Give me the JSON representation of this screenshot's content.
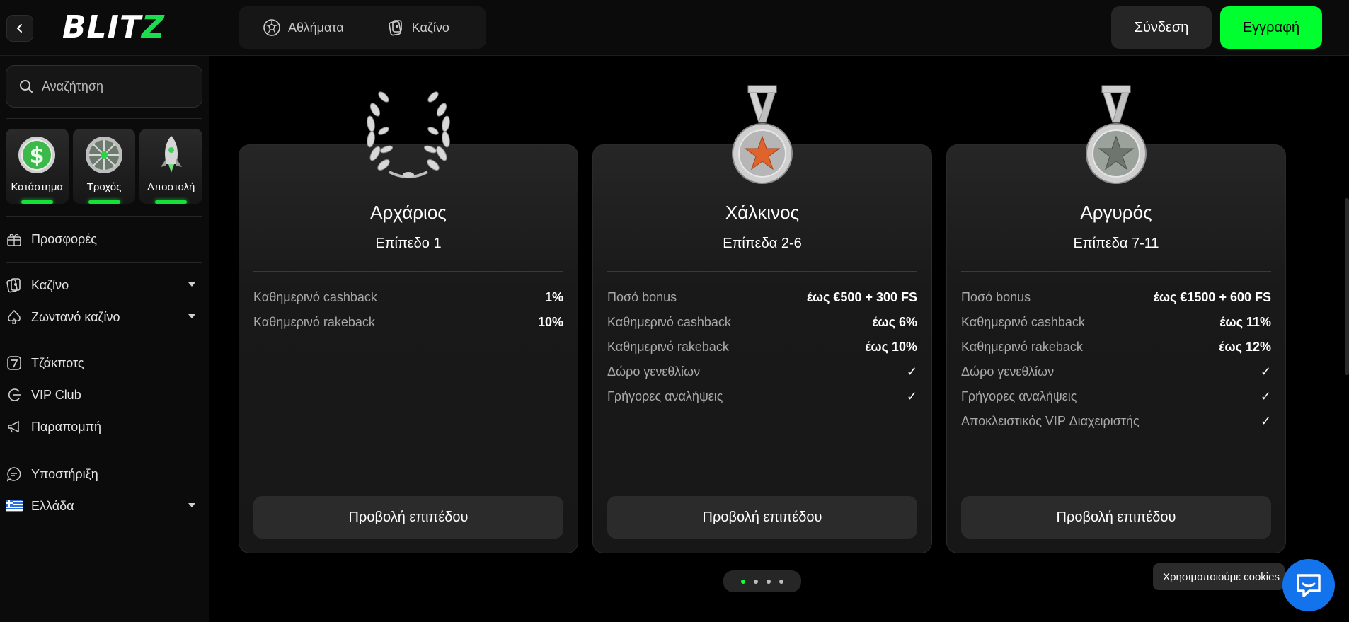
{
  "header": {
    "logo_text": "BLITZ",
    "nav": [
      {
        "label": "Αθλήματα",
        "icon": "soccer-ball-icon"
      },
      {
        "label": "Καζίνο",
        "icon": "cards-icon"
      }
    ],
    "login_label": "Σύνδεση",
    "register_label": "Εγγραφή"
  },
  "sidebar": {
    "search_placeholder": "Αναζήτηση",
    "promos": [
      {
        "label": "Κατάστημα",
        "icon": "dollar-coin-icon"
      },
      {
        "label": "Τροχός",
        "icon": "wheel-icon"
      },
      {
        "label": "Αποστολή",
        "icon": "rocket-icon"
      }
    ],
    "menu": [
      {
        "label": "Προσφορές",
        "icon": "gift-icon",
        "dropdown": false
      },
      {
        "label": "Καζίνο",
        "icon": "casino-cards-icon",
        "dropdown": true
      },
      {
        "label": "Ζωντανό καζίνο",
        "icon": "spade-icon",
        "dropdown": true
      },
      {
        "label": "Τζάκποτς",
        "icon": "seven-icon",
        "dropdown": false
      },
      {
        "label": "VIP Club",
        "icon": "vip-icon",
        "dropdown": false
      },
      {
        "label": "Παραπομπή",
        "icon": "megaphone-icon",
        "dropdown": false
      },
      {
        "label": "Υποστήριξη",
        "icon": "chat-bubble-icon",
        "dropdown": false
      },
      {
        "label": "Ελλάδα",
        "icon": "greece-flag-icon",
        "dropdown": true
      }
    ]
  },
  "cards": [
    {
      "name": "Αρχάριος",
      "level": "Επίπεδο 1",
      "medal": "laurel-wreath-icon",
      "rows": [
        {
          "k": "Καθημερινό cashback",
          "v": "1%"
        },
        {
          "k": "Καθημερινό rakeback",
          "v": "10%"
        }
      ],
      "cta": "Προβολή επιπέδου"
    },
    {
      "name": "Χάλκινος",
      "level": "Επίπεδα 2-6",
      "medal": "bronze-medal-icon",
      "rows": [
        {
          "k": "Ποσό bonus",
          "v": "έως €500 + 300 FS"
        },
        {
          "k": "Καθημερινό cashback",
          "v": "έως 6%"
        },
        {
          "k": "Καθημερινό rakeback",
          "v": "έως 10%"
        },
        {
          "k": "Δώρο γενεθλίων",
          "v": "✓"
        },
        {
          "k": "Γρήγορες αναλήψεις",
          "v": "✓"
        }
      ],
      "cta": "Προβολή επιπέδου"
    },
    {
      "name": "Αργυρός",
      "level": "Επίπεδα 7-11",
      "medal": "silver-medal-icon",
      "rows": [
        {
          "k": "Ποσό bonus",
          "v": "έως €1500 + 600 FS"
        },
        {
          "k": "Καθημερινό cashback",
          "v": "έως 11%"
        },
        {
          "k": "Καθημερινό rakeback",
          "v": "έως 12%"
        },
        {
          "k": "Δώρο γενεθλίων",
          "v": "✓"
        },
        {
          "k": "Γρήγορες αναλήψεις",
          "v": "✓"
        },
        {
          "k": "Αποκλειστικός VIP Διαχειριστής",
          "v": "✓"
        }
      ],
      "cta": "Προβολή επιπέδου"
    }
  ],
  "pager": {
    "total": 4,
    "active": 1
  },
  "cookie_text": "Χρησιμοποιούμε cookies",
  "colors": {
    "accent": "#00ff2f",
    "bronze_star": "#e0632b",
    "chat": "#1273ec"
  }
}
